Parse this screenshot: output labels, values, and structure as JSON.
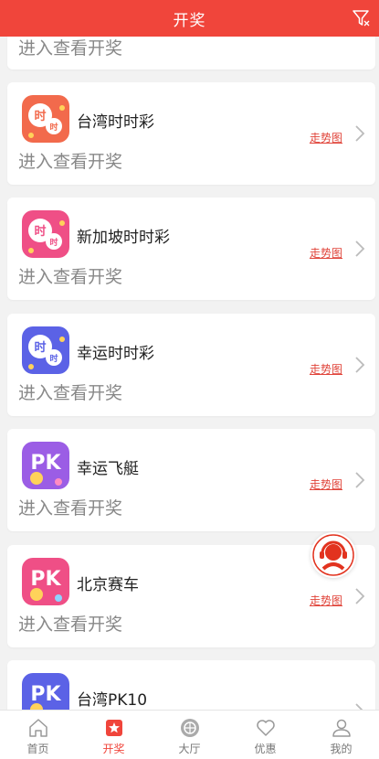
{
  "header": {
    "title": "开奖"
  },
  "enter_label": "进入查看开奖",
  "trend_label": "走势图",
  "partial_top": {
    "enter_label": "进入查看开奖"
  },
  "lotteries": [
    {
      "name": "台湾时时彩",
      "icon": "time-lottery-icon",
      "color": "#f26a4c",
      "glyph": "时"
    },
    {
      "name": "新加坡时时彩",
      "icon": "time-lottery-icon",
      "color": "#ef4f86",
      "glyph": "时"
    },
    {
      "name": "幸运时时彩",
      "icon": "time-lottery-icon",
      "color": "#5b62e6",
      "glyph": "时"
    },
    {
      "name": "幸运飞艇",
      "icon": "pk-icon",
      "color": "#9b5de5",
      "glyph": "PK"
    },
    {
      "name": "北京赛车",
      "icon": "pk-icon",
      "color": "#ef4f86",
      "glyph": "PK"
    },
    {
      "name": "台湾PK10",
      "icon": "pk-icon",
      "color": "#5b62e6",
      "glyph": "PK"
    }
  ],
  "tabs": [
    {
      "label": "首页",
      "icon": "home-icon"
    },
    {
      "label": "开奖",
      "icon": "lottery-icon",
      "active": true
    },
    {
      "label": "大厅",
      "icon": "lobby-icon"
    },
    {
      "label": "优惠",
      "icon": "heart-icon"
    },
    {
      "label": "我的",
      "icon": "profile-icon"
    }
  ],
  "colors": {
    "brand": "#f0453b",
    "link": "#e0443a"
  }
}
